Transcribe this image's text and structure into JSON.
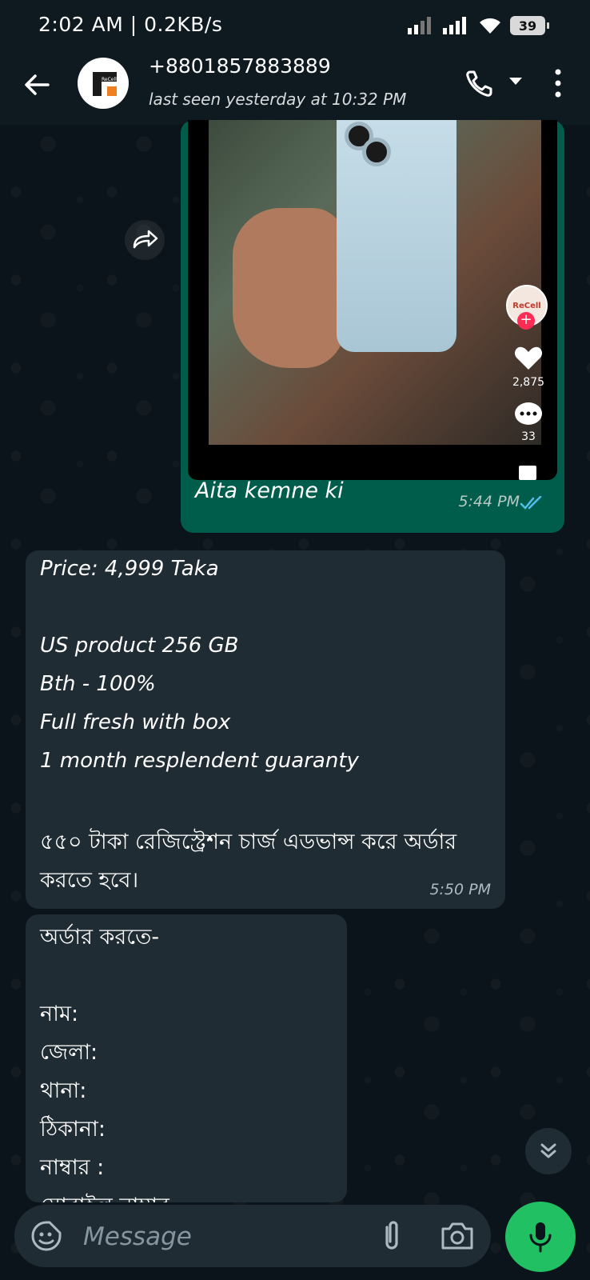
{
  "status_bar": {
    "time": "2:02 AM",
    "separator": "|",
    "net_speed": "0.2KB/s",
    "battery": "39"
  },
  "header": {
    "contact": "+8801857883889",
    "last_seen": "last seen yesterday at 10:32 PM",
    "avatar_text": "ReCell"
  },
  "outgoing_message": {
    "caption": "Aita kemne ki",
    "time": "5:44 PM",
    "media": {
      "overlay_avatar_text": "ReCell",
      "likes": "2,875",
      "comments": "33"
    }
  },
  "incoming_messages": [
    {
      "lines": [
        "Price: 4,999 Taka",
        "",
        "US product 256 GB",
        "Bth - 100%",
        "Full fresh with box",
        "1 month resplendent guaranty",
        "",
        "৫৫০ টাকা রেজিস্ট্রেশন চার্জ এডভান্স করে অর্ডার",
        "করতে হবে।"
      ],
      "time": "5:50 PM"
    },
    {
      "lines": [
        "অর্ডার করতে-",
        "",
        "নাম:",
        "জেলা:",
        "থানা:",
        "ঠিকানা:",
        "নাম্বার :",
        "মোবাইল নাম্বার"
      ]
    }
  ],
  "input": {
    "placeholder": "Message"
  },
  "colors": {
    "outgoing_bubble": "#005c4b",
    "incoming_bubble": "#202c33",
    "accent_green": "#21c063",
    "read_ticks": "#53bdeb"
  }
}
